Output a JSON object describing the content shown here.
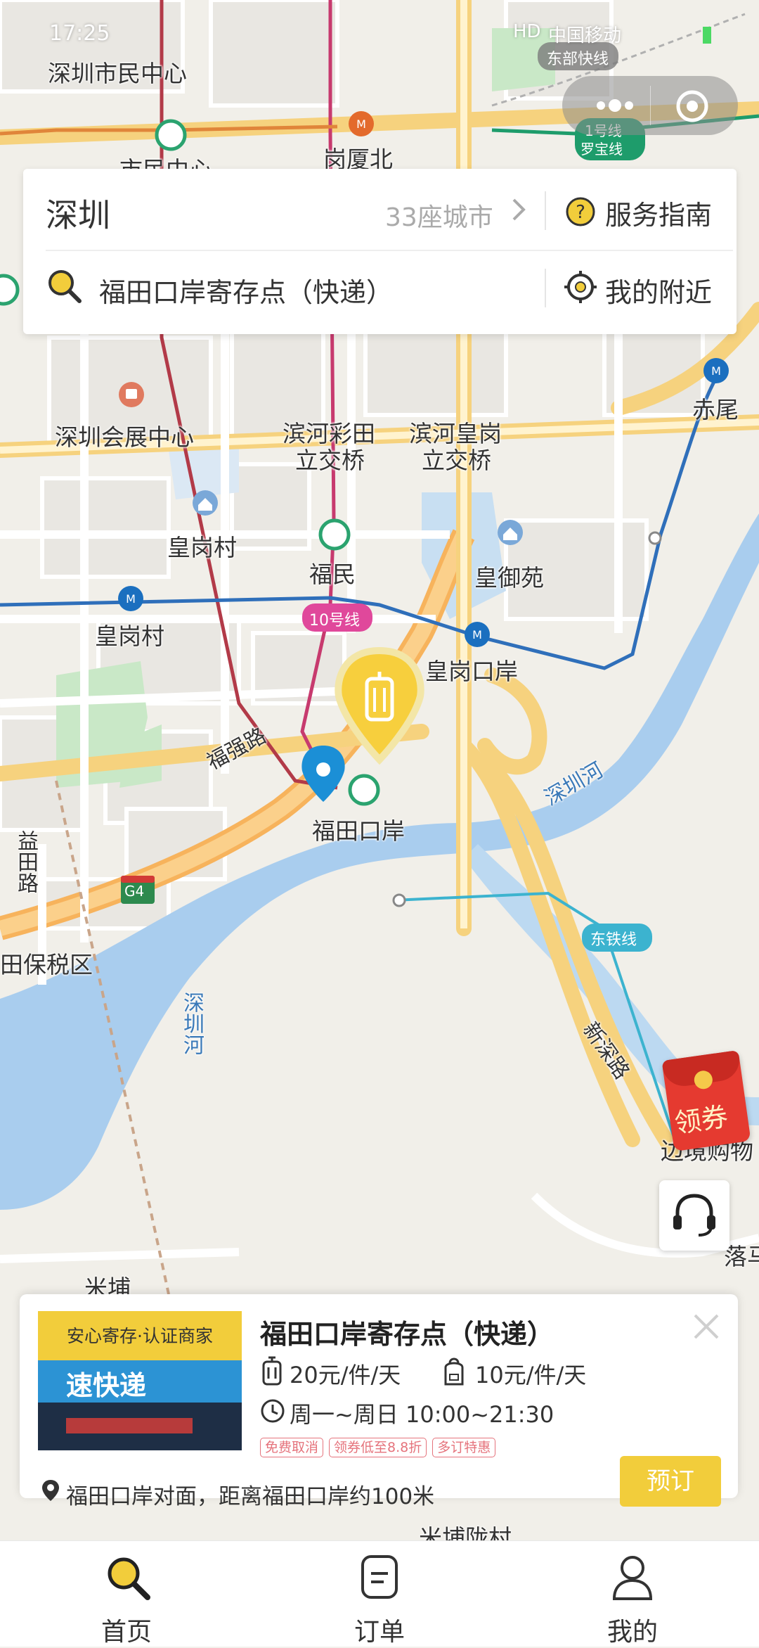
{
  "status_bar": {
    "time": "17:25",
    "network": "HD",
    "carrier": "中国移动"
  },
  "search_card": {
    "city": "深圳",
    "city_count": "33座城市",
    "service_guide": "服务指南",
    "search_text": "福田口岸寄存点（快递）",
    "nearby": "我的附近"
  },
  "map": {
    "labels": {
      "shimin": "深圳市民中心",
      "shimin_short": "市民中心",
      "gangxia": "岗厦北",
      "huizhan": "深圳会展中心",
      "binhe_caitian": "滨河彩田",
      "binhe_caitian_2": "立交桥",
      "binhe_huanggang": "滨河皇岗",
      "binhe_huanggang_2": "立交桥",
      "chiwei": "赤尾",
      "huanggangcun_n": "皇岗村",
      "fumin": "福民",
      "huangyuyuan": "皇御苑",
      "huanggangcun_s": "皇岗村",
      "huanggang_port": "皇岗口岸",
      "line10": "10号线",
      "fuqiang": "福强路",
      "futian_port": "福田口岸",
      "shenzhen_river_1": "深圳河",
      "yitian": "益田路",
      "g4": "G4",
      "baoshui": "田保税区",
      "shenzhen_river_2": "深圳河",
      "east_rail": "东铁线",
      "xinshen": "新深路",
      "border_shop": "边境购物",
      "mipu": "米埔",
      "mipu_long": "米埔陇村",
      "east_express": "东部快线",
      "line1": "1号线",
      "luobao": "罗宝线",
      "luoma": "落马",
      "coupon": "领券"
    }
  },
  "store_card": {
    "badge": "安心寄存·认证商家",
    "title": "福田口岸寄存点（快递）",
    "price_large": "20元/件/天",
    "price_small": "10元/件/天",
    "hours": "周一~周日 10:00~21:30",
    "tags": [
      "免费取消",
      "领券低至8.8折",
      "多订特惠"
    ],
    "address": "福田口岸对面，距离福田口岸约100米",
    "book_button": "预订",
    "photo_sign": "速快递",
    "accent_color": "#f2cd3b"
  },
  "tabbar": {
    "items": [
      {
        "label": "首页",
        "icon": "search-icon",
        "active": true
      },
      {
        "label": "订单",
        "icon": "order-icon",
        "active": false
      },
      {
        "label": "我的",
        "icon": "user-icon",
        "active": false
      }
    ]
  }
}
